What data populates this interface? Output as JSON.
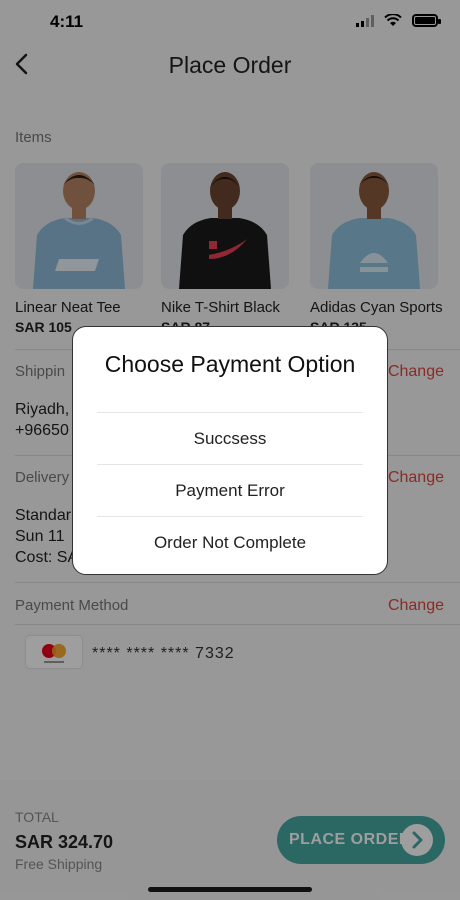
{
  "status_bar": {
    "time": "4:11"
  },
  "header": {
    "title": "Place Order"
  },
  "items_section": {
    "label": "Items",
    "items": [
      {
        "name": "Linear Neat Tee",
        "price": "SAR 105",
        "shirt_color": "#8fb8d8"
      },
      {
        "name": "Nike T-Shirt Black",
        "price": "SAR 87",
        "shirt_color": "#1a1a1a"
      },
      {
        "name": "Adidas Cyan Sports",
        "price": "SAR 135",
        "shirt_color": "#8fc0dc"
      }
    ]
  },
  "shipping": {
    "label": "Shippin",
    "change": "Change",
    "line1": "Riyadh,",
    "line2": "+96650"
  },
  "delivery": {
    "label": "Delivery",
    "change": "Change",
    "line1": "Standar",
    "line2": "Sun 11",
    "line3": "Cost: SA"
  },
  "payment": {
    "label": "Payment Method",
    "change": "Change",
    "card_number": "**** **** **** 7332"
  },
  "footer": {
    "total_label": "TOTAL",
    "total_value": "SAR 324.70",
    "shipping_note": "Free Shipping",
    "place_order": "PLACE ORDER"
  },
  "modal": {
    "title": "Choose Payment Option",
    "options": [
      "Succsess",
      "Payment Error",
      "Order Not Complete"
    ]
  },
  "colors": {
    "accent": "#46a7a1",
    "change": "#e0463b"
  }
}
